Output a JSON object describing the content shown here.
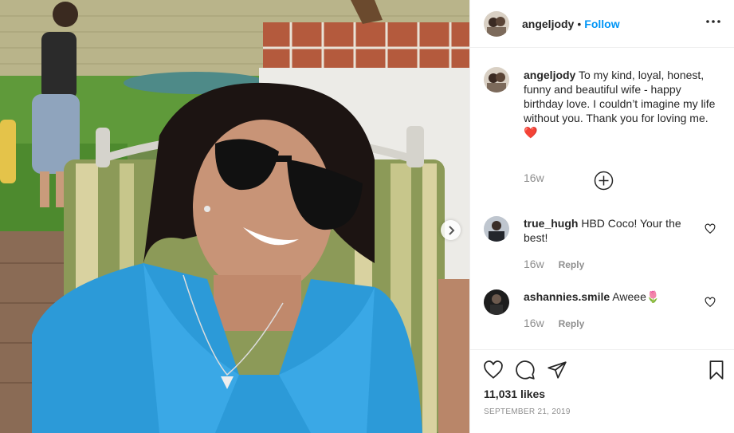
{
  "header": {
    "username": "angeljody",
    "separator": "•",
    "follow_label": "Follow",
    "more_icon": "more-horizontal-icon"
  },
  "caption": {
    "username": "angeljody",
    "text": "To my kind, loyal, honest, funny and beautiful wife - happy birthday love. I couldn’t imagine my life without you. Thank you for loving me.",
    "emoji": "❤️",
    "time": "16w"
  },
  "load_more_icon": "plus-circle-icon",
  "comments": [
    {
      "username": "true_hugh",
      "text": "HBD Coco! Your the best!",
      "time": "16w",
      "reply_label": "Reply"
    },
    {
      "username": "ashannies.smile",
      "text": "Aweee",
      "emoji": "🌷",
      "time": "16w",
      "reply_label": "Reply"
    }
  ],
  "actions": {
    "like_icon": "heart-icon",
    "comment_icon": "comment-icon",
    "share_icon": "paper-plane-icon",
    "save_icon": "bookmark-icon"
  },
  "likes": "11,031 likes",
  "date": "SEPTEMBER 21, 2019",
  "colors": {
    "link_blue": "#0095f6",
    "text": "#262626",
    "secondary": "#8e8e8e",
    "heart_red": "#ed4956",
    "sweater_blue": "#2c9ad8"
  }
}
